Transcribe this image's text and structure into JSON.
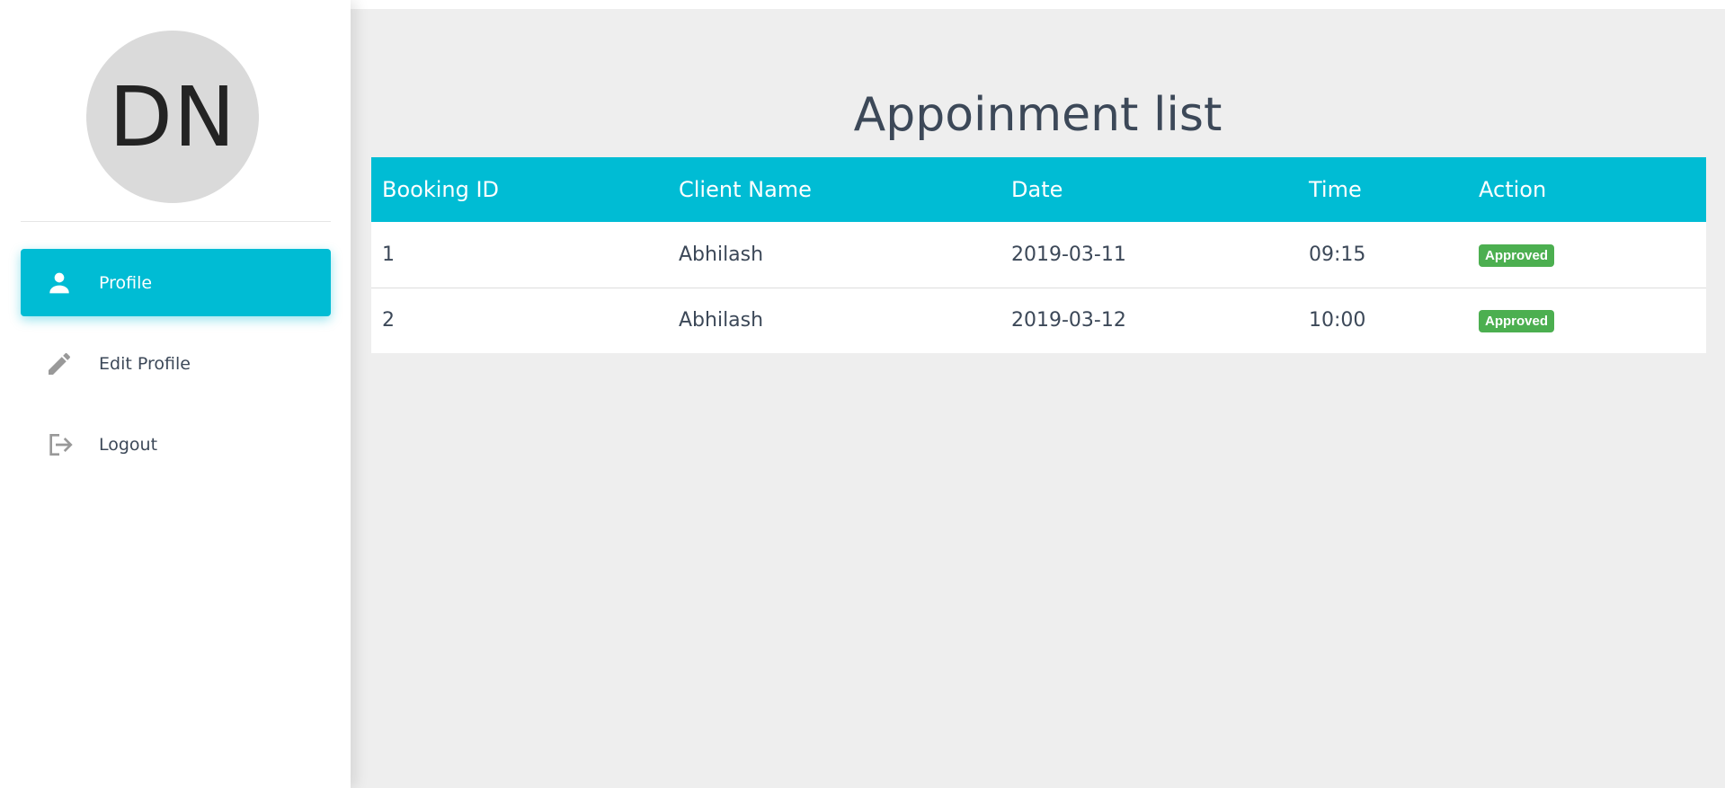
{
  "sidebar": {
    "avatar_initials": "DN",
    "items": [
      {
        "label": "Profile",
        "icon": "person-icon",
        "active": true
      },
      {
        "label": "Edit Profile",
        "icon": "pencil-icon",
        "active": false
      },
      {
        "label": "Logout",
        "icon": "logout-icon",
        "active": false
      }
    ]
  },
  "main": {
    "title": "Appoinment list",
    "table": {
      "headers": [
        "Booking ID",
        "Client Name",
        "Date",
        "Time",
        "Action"
      ],
      "rows": [
        {
          "booking_id": "1",
          "client_name": "Abhilash",
          "date": "2019-03-11",
          "time": "09:15",
          "action": "Approved"
        },
        {
          "booking_id": "2",
          "client_name": "Abhilash",
          "date": "2019-03-12",
          "time": "10:00",
          "action": "Approved"
        }
      ]
    }
  },
  "colors": {
    "accent": "#00bcd4",
    "approved": "#4caf50",
    "text": "#3c4858",
    "main_background": "#eeeeee"
  }
}
